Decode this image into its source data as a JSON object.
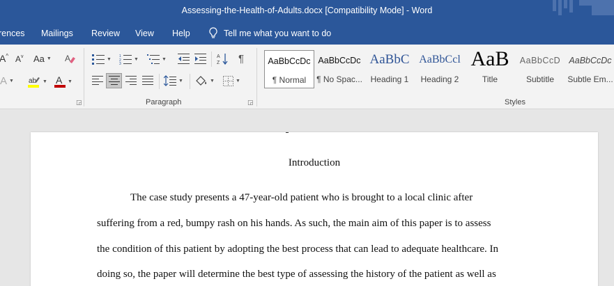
{
  "window": {
    "title": "Assessing-the-Health-of-Adults.docx [Compatibility Mode]  -  Word"
  },
  "tabs": [
    {
      "label": "rences"
    },
    {
      "label": "Mailings"
    },
    {
      "label": "Review"
    },
    {
      "label": "View"
    },
    {
      "label": "Help"
    }
  ],
  "tell_me": {
    "placeholder": "Tell me what you want to do"
  },
  "font_group": {
    "grow_label": "A",
    "shrink_label": "A",
    "case_label": "Aa",
    "clear_label": "A",
    "highlight_label": "ab",
    "color_label": "A",
    "effects_label": "A"
  },
  "paragraph_group": {
    "label": "Paragraph",
    "pilcrow": "¶"
  },
  "styles_group": {
    "label": "Styles",
    "items": [
      {
        "sample": "AaBbCcDc",
        "name": "¶ Normal"
      },
      {
        "sample": "AaBbCcDc",
        "name": "¶ No Spac..."
      },
      {
        "sample": "AaBbC",
        "name": "Heading 1"
      },
      {
        "sample": "AaBbCcl",
        "name": "Heading 2"
      },
      {
        "sample": "AaB",
        "name": "Title"
      },
      {
        "sample": "AaBbCcD",
        "name": "Subtitle"
      },
      {
        "sample": "AaBbCcDc",
        "name": "Subtle Em..."
      }
    ]
  },
  "colors": {
    "accent": "#2b579a",
    "highlight": "#ffff00",
    "font_color": "#c00000"
  },
  "document": {
    "heading": "Introduction",
    "lines": [
      "The case study presents a 47-year-old patient who is brought to a local clinic after",
      "suffering from a red, bumpy rash on his hands. As such, the main aim of this paper is to assess",
      "the condition of this patient by adopting the best process that can lead to adequate healthcare. In",
      "doing so, the paper will determine the best type of assessing the history of the patient as well as"
    ]
  }
}
